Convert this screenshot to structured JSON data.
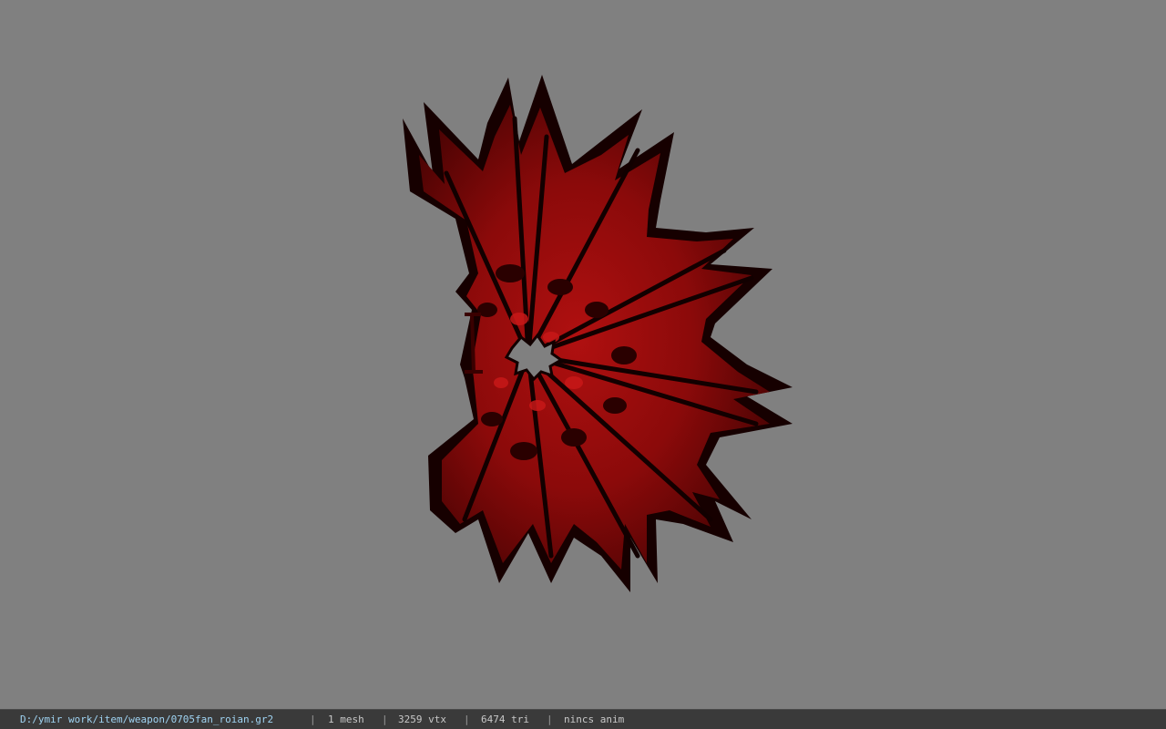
{
  "status": {
    "file_path": "D:/ymir work/item/weapon/0705fan_roian.gr2",
    "separator": "|",
    "mesh_count": "1 mesh",
    "vertex_count": "3259 vtx",
    "triangle_count": "6474 tri",
    "animation": "nincs anim"
  },
  "colors": {
    "viewport_background": "#808080",
    "statusbar_background": "#3a3a3a",
    "path_text": "#9fd3f2",
    "model_red": "#8b0a0a",
    "model_dark": "#120000"
  },
  "viewport": {
    "model_icon": "spiked-fan-model"
  }
}
